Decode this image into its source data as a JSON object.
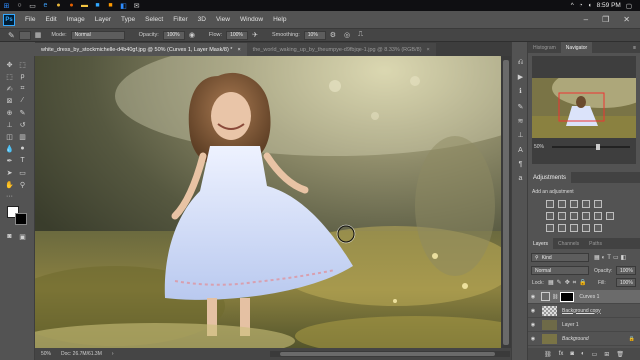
{
  "taskbar": {
    "start_icon": "windows-logo-icon",
    "apps": [
      "search-icon",
      "task-view-icon",
      "edge-icon",
      "chrome-icon",
      "firefox-icon",
      "explorer-icon",
      "photoshop-icon",
      "illustrator-icon",
      "store-icon",
      "mail-icon"
    ],
    "clock": "8:59 PM"
  },
  "menubar": {
    "logo": "Ps",
    "items": [
      "File",
      "Edit",
      "Image",
      "Layer",
      "Type",
      "Select",
      "Filter",
      "3D",
      "View",
      "Window",
      "Help"
    ],
    "controls": [
      "–",
      "❐",
      "✕"
    ]
  },
  "options": {
    "mode_label": "Mode:",
    "mode_value": "Normal",
    "opacity_label": "Opacity:",
    "opacity_value": "100%",
    "flow_label": "Flow:",
    "flow_value": "100%",
    "smoothing_label": "Smoothing:",
    "smoothing_value": "10%"
  },
  "tabs": [
    {
      "label": "white_dress_by_stockmichelle-d4b40gf.jpg @ 50% (Curves 1, Layer Mask/8) *",
      "close": "×"
    },
    {
      "label": "the_world_waking_up_by_theumpye-d9fbjqe-1.jpg @ 8.33% (RGB/8)",
      "close": "×"
    }
  ],
  "status": {
    "zoom": "50%",
    "doc": "Doc: 26.7M/61.3M"
  },
  "panels": {
    "top_tabs": [
      "Histogram",
      "Navigator"
    ],
    "nav_zoom": "50%",
    "adjustments_title": "Adjustments",
    "adjustments_hint": "Add an adjustment",
    "layers_tabs": [
      "Layers",
      "Channels",
      "Paths"
    ],
    "kind_label": "Kind",
    "blend_mode": "Normal",
    "opacity_label": "Opacity:",
    "opacity_value": "100%",
    "lock_label": "Lock:",
    "fill_label": "Fill:",
    "fill_value": "100%",
    "layers": [
      {
        "name": "Curves 1",
        "selected": true
      },
      {
        "name": "Background copy",
        "selected": false
      },
      {
        "name": "Layer 1",
        "selected": false
      },
      {
        "name": "Background",
        "selected": false
      }
    ]
  },
  "colors": {
    "ps_blue": "#31a8ff",
    "panel_bg": "#535353",
    "dark_bg": "#3d3d3d"
  }
}
